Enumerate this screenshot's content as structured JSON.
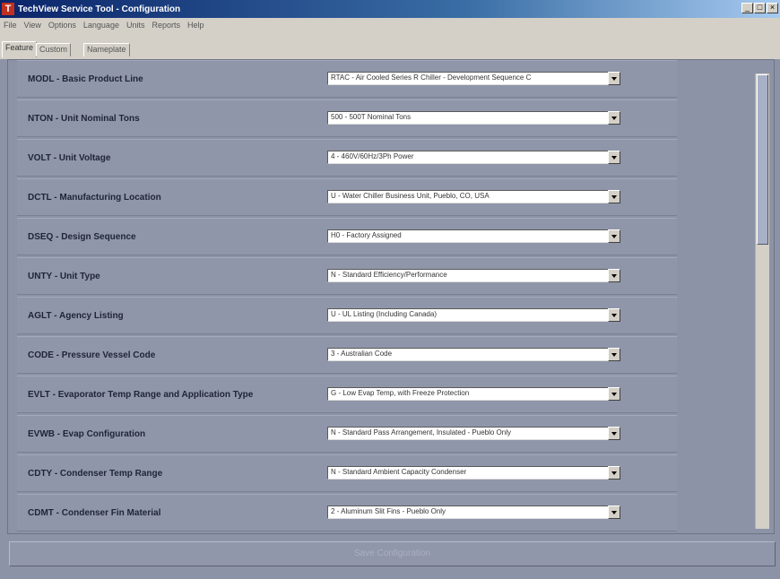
{
  "window": {
    "title": "TechView Service Tool - Configuration",
    "controls": [
      "_",
      "□",
      "×"
    ]
  },
  "menubar": [
    "File",
    "View",
    "Options",
    "Language",
    "Units",
    "Reports",
    "Help"
  ],
  "tabs": [
    {
      "label": "Feature",
      "active": true
    },
    {
      "label": "Custom",
      "active": false
    },
    {
      "label": "Nameplate",
      "active": false
    }
  ],
  "rows": [
    {
      "label": "MODL - Basic Product Line",
      "value": "RTAC - Air Cooled Series R Chiller - Development Sequence C"
    },
    {
      "label": "NTON - Unit Nominal Tons",
      "value": "500 - 500T Nominal Tons"
    },
    {
      "label": "VOLT - Unit Voltage",
      "value": "4 - 460V/60Hz/3Ph Power"
    },
    {
      "label": "DCTL - Manufacturing Location",
      "value": "U - Water Chiller Business Unit, Pueblo, CO, USA"
    },
    {
      "label": "DSEQ - Design Sequence",
      "value": "H0 - Factory Assigned"
    },
    {
      "label": "UNTY - Unit Type",
      "value": "N - Standard Efficiency/Performance"
    },
    {
      "label": "AGLT - Agency Listing",
      "value": "U - UL Listing (Including Canada)"
    },
    {
      "label": "CODE - Pressure Vessel Code",
      "value": "3 - Australian Code"
    },
    {
      "label": "EVLT - Evaporator Temp Range and Application Type",
      "value": "G - Low Evap Temp, with Freeze Protection"
    },
    {
      "label": "EVWB - Evap Configuration",
      "value": "N - Standard Pass Arrangement, Insulated - Pueblo Only"
    },
    {
      "label": "CDTY - Condenser Temp Range",
      "value": "N - Standard Ambient Capacity Condenser"
    },
    {
      "label": "CDMT - Condenser Fin Material",
      "value": "2 - Aluminum Slit Fins - Pueblo Only"
    }
  ],
  "footer": {
    "button_label": "Save Configuration"
  },
  "colors": {
    "titlebar": "#0a246a",
    "background": "#8c93a6",
    "row": "#8f96a9",
    "label_text": "#1f2438"
  }
}
